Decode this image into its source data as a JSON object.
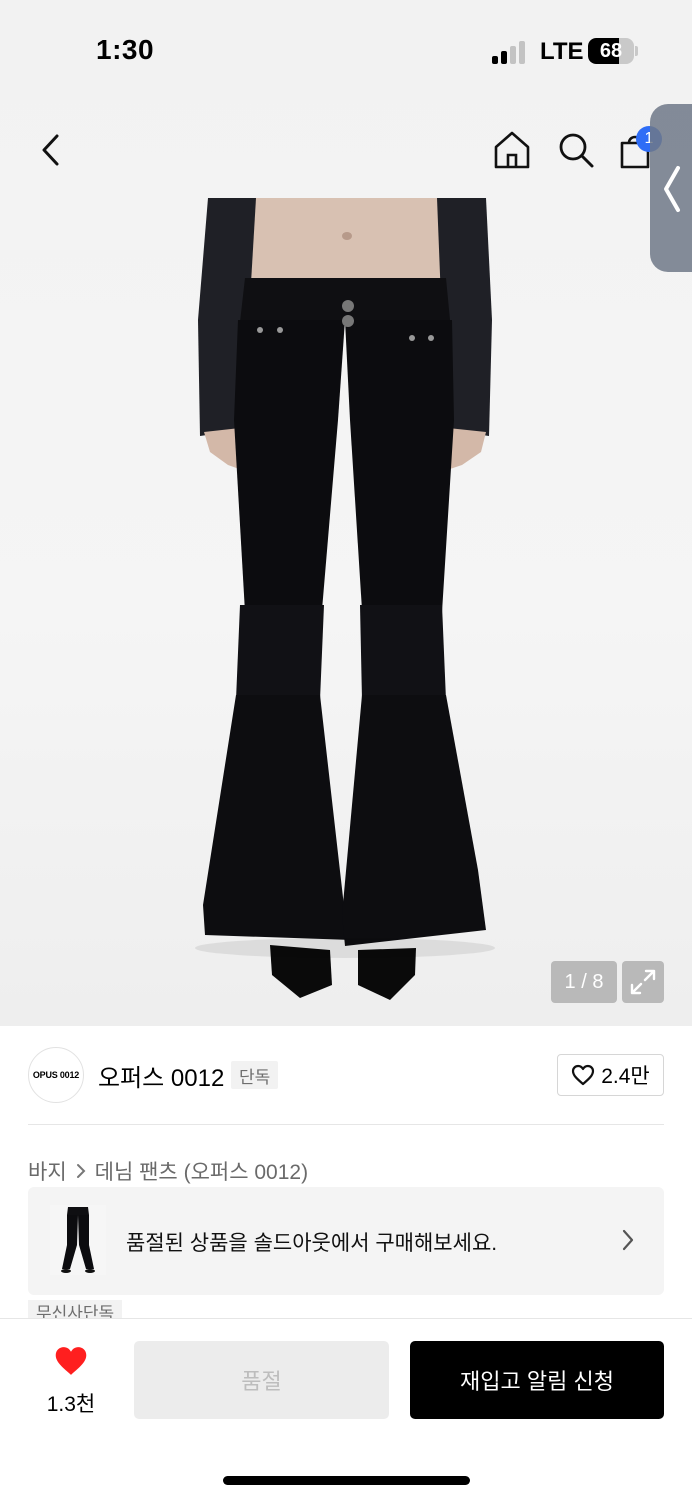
{
  "status_bar": {
    "time": "1:30",
    "network": "LTE",
    "battery": "68",
    "battery_level": 0.68
  },
  "nav": {
    "cart_count": "1"
  },
  "gallery": {
    "counter": "1 / 8"
  },
  "brand": {
    "logo_text": "OPUS 0012",
    "name": "오퍼스 0012",
    "tag": "단독",
    "likes": "2.4만"
  },
  "breadcrumb": {
    "items": [
      "바지",
      "데님 팬츠 (오퍼스 0012)"
    ]
  },
  "soldout_banner": {
    "text": "품절된 상품을 솔드아웃에서 구매해보세요."
  },
  "badge": {
    "musinsa": "무신사단독"
  },
  "bottom_bar": {
    "like_count": "1.3천",
    "soldout_label": "품절",
    "restock_label": "재입고 알림 신청"
  },
  "colors": {
    "accent_blue": "#2f6df6",
    "heart_red": "#ff1f1f",
    "primary_black": "#000000"
  },
  "icons": [
    "back-icon",
    "home-icon",
    "search-icon",
    "cart-icon",
    "expand-icon",
    "heart-outline-icon",
    "chevron-right-icon",
    "heart-filled-icon"
  ]
}
